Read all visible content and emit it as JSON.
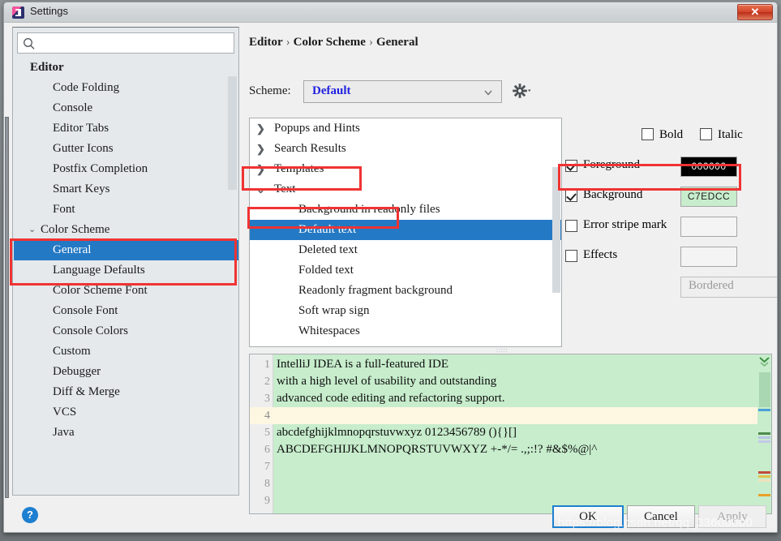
{
  "window": {
    "title": "Settings",
    "close_label": "✕",
    "app_icon": "intellij-idea-icon"
  },
  "search": {
    "placeholder": "",
    "value": "",
    "icon": "search-icon"
  },
  "sidebar": {
    "items": [
      {
        "label": "Editor",
        "level": 0,
        "chevron": ""
      },
      {
        "label": "Code Folding",
        "level": 1,
        "chevron": ""
      },
      {
        "label": "Console",
        "level": 1,
        "chevron": ""
      },
      {
        "label": "Editor Tabs",
        "level": 1,
        "chevron": ""
      },
      {
        "label": "Gutter Icons",
        "level": 1,
        "chevron": ""
      },
      {
        "label": "Postfix Completion",
        "level": 1,
        "chevron": ""
      },
      {
        "label": "Smart Keys",
        "level": 1,
        "chevron": ""
      },
      {
        "label": "Font",
        "level": 1,
        "chevron": ""
      },
      {
        "label": "Color Scheme",
        "level": 1,
        "chevron": "⌄",
        "expanded": true
      },
      {
        "label": "General",
        "level": 2,
        "chevron": "",
        "selected": true
      },
      {
        "label": "Language Defaults",
        "level": 2,
        "chevron": ""
      },
      {
        "label": "Color Scheme Font",
        "level": 2,
        "chevron": ""
      },
      {
        "label": "Console Font",
        "level": 2,
        "chevron": ""
      },
      {
        "label": "Console Colors",
        "level": 2,
        "chevron": ""
      },
      {
        "label": "Custom",
        "level": 2,
        "chevron": ""
      },
      {
        "label": "Debugger",
        "level": 2,
        "chevron": ""
      },
      {
        "label": "Diff & Merge",
        "level": 2,
        "chevron": ""
      },
      {
        "label": "VCS",
        "level": 2,
        "chevron": ""
      },
      {
        "label": "Java",
        "level": 2,
        "chevron": ""
      }
    ]
  },
  "main": {
    "breadcrumb": {
      "part1": "Editor",
      "sep1": "›",
      "part2": "Color Scheme",
      "sep2": "›",
      "part3": "General"
    },
    "scheme": {
      "label": "Scheme:",
      "value": "Default",
      "gear_icon": "gear-icon",
      "chevron_icon": "chevron-down-icon"
    }
  },
  "attributes": {
    "items": [
      {
        "label": "Popups and Hints",
        "type": "parent",
        "chevron": "❯"
      },
      {
        "label": "Search Results",
        "type": "parent",
        "chevron": "❯"
      },
      {
        "label": "Templates",
        "type": "parent",
        "chevron": "❯"
      },
      {
        "label": "Text",
        "type": "parent",
        "chevron": "⌄",
        "expanded": true,
        "highlighted": true
      },
      {
        "label": "Background in readonly files",
        "type": "child"
      },
      {
        "label": "Default text",
        "type": "child",
        "selected": true,
        "highlighted": true
      },
      {
        "label": "Deleted text",
        "type": "child"
      },
      {
        "label": "Folded text",
        "type": "child"
      },
      {
        "label": "Readonly fragment background",
        "type": "child"
      },
      {
        "label": "Soft wrap sign",
        "type": "child"
      },
      {
        "label": "Whitespaces",
        "type": "child"
      }
    ]
  },
  "options": {
    "bold": {
      "label": "Bold",
      "checked": false
    },
    "italic": {
      "label": "Italic",
      "checked": false
    },
    "foreground": {
      "label": "Foreground",
      "checked": true,
      "color": "000000",
      "swatch_bg": "#000000",
      "swatch_fg": "#ffffff"
    },
    "background": {
      "label": "Background",
      "checked": true,
      "color": "C7EDCC",
      "swatch_bg": "#c7edcc",
      "swatch_fg": "#222222",
      "highlighted": true
    },
    "error_stripe": {
      "label": "Error stripe mark",
      "checked": false,
      "color": ""
    },
    "effects": {
      "label": "Effects",
      "checked": false,
      "color": ""
    },
    "effect_type": {
      "value": "Bordered",
      "disabled": true
    }
  },
  "preview": {
    "background_color": "#c7edcc",
    "lines": [
      {
        "num": "1",
        "text": "IntelliJ IDEA is a full-featured IDE"
      },
      {
        "num": "2",
        "text": "with a high level of usability and outstanding"
      },
      {
        "num": "3",
        "text": "advanced code editing and refactoring support."
      },
      {
        "num": "4",
        "text": "",
        "caret": true
      },
      {
        "num": "5",
        "text": "abcdefghijklmnopqrstuvwxyz 0123456789 (){}[]"
      },
      {
        "num": "6",
        "text": "ABCDEFGHIJKLMNOPQRSTUVWXYZ +-*/= .,;:!? #&$%@|^"
      },
      {
        "num": "7",
        "text": ""
      },
      {
        "num": "8",
        "text": ""
      },
      {
        "num": "9",
        "text": ""
      }
    ]
  },
  "footer": {
    "help_label": "?",
    "ok_label": "OK",
    "cancel_label": "Cancel",
    "apply_label": "Apply"
  },
  "watermark": "https://blog.csdn.net/qq_33608000"
}
